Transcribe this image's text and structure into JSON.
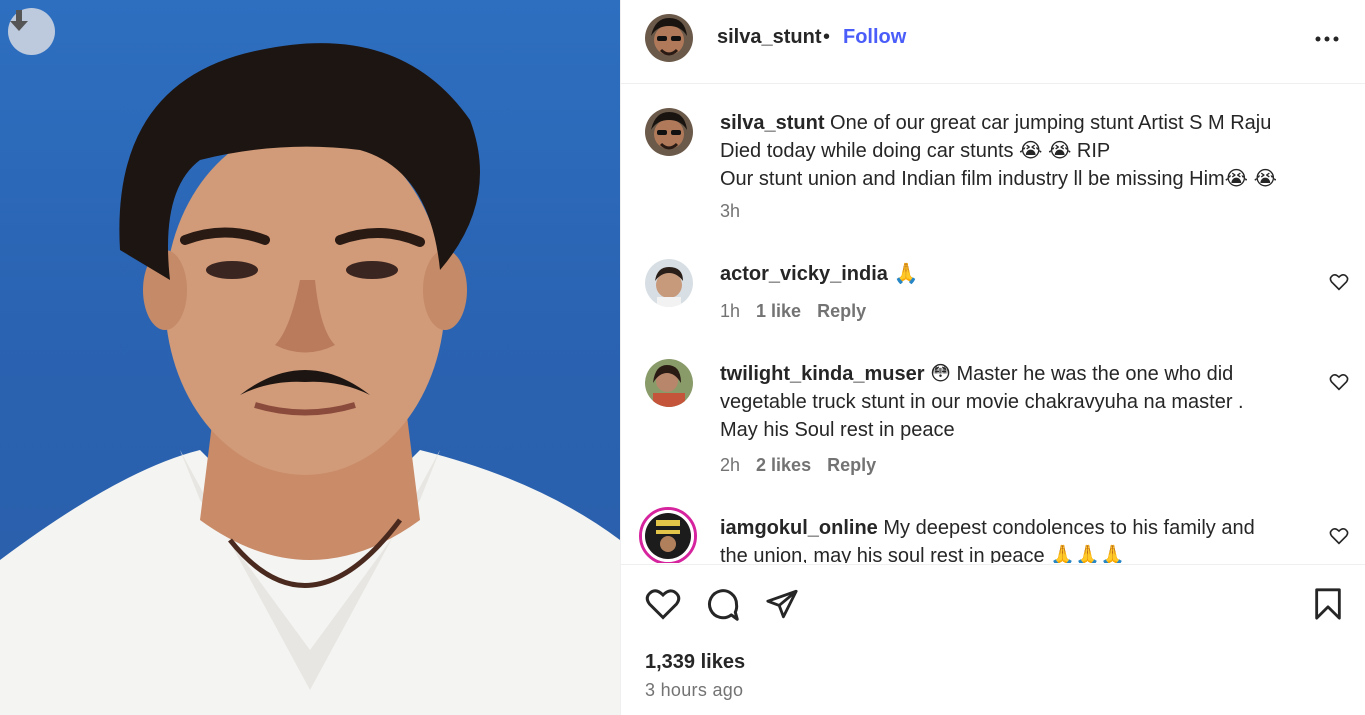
{
  "post": {
    "author": "silva_stunt",
    "separator": "•",
    "follow_label": "Follow",
    "caption_line1": "One of our great car jumping stunt Artist S M Raju",
    "caption_line2": "Died today while doing car stunts 😭 😭 RIP",
    "caption_line3": "Our stunt union and Indian film industry ll be missing Him😭 😭",
    "caption_time": "3h",
    "likes": "1,339 likes",
    "posted_ago": "3 hours ago"
  },
  "comments": [
    {
      "username": "actor_vicky_india",
      "text": "🙏",
      "time": "1h",
      "likes": "1 like",
      "reply": "Reply"
    },
    {
      "username": "twilight_kinda_muser",
      "text_line1": "😳  Master he was the one who did",
      "text_line2": "vegetable truck stunt in our movie chakravyuha na master .",
      "text_line3": "May his Soul rest in peace",
      "time": "2h",
      "likes": "2 likes",
      "reply": "Reply"
    },
    {
      "username": "iamgokul_online",
      "text_line1": "My deepest condolences to his family and",
      "text_line2": "the union, may his soul rest in peace 🙏🙏🙏"
    }
  ],
  "icons": {
    "download": "download-icon",
    "more": "more-options-icon",
    "like": "heart-icon",
    "comment": "comment-icon",
    "share": "share-icon",
    "save": "bookmark-icon"
  },
  "colors": {
    "follow": "#4a5df9",
    "photo_background": "#2e6fc0",
    "muted_text": "#737373",
    "story_ring": "#d6249f"
  }
}
